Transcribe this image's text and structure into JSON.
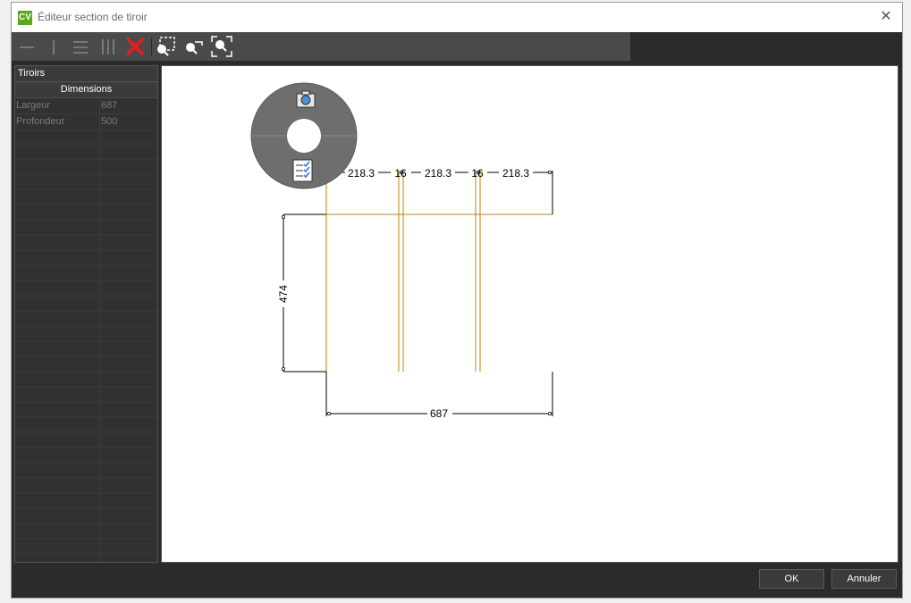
{
  "window": {
    "app_icon_text": "CV",
    "title": "Éditeur section de tiroir"
  },
  "toolbar": {
    "items": [
      {
        "icon": "horizontal-line-icon"
      },
      {
        "icon": "vertical-line-icon"
      },
      {
        "icon": "horizontal-lines-icon"
      },
      {
        "icon": "vertical-lines-icon"
      },
      {
        "icon": "delete-icon"
      },
      {
        "icon": "zoom-window-icon"
      },
      {
        "icon": "zoom-out-icon"
      },
      {
        "icon": "zoom-extents-icon"
      }
    ]
  },
  "panel": {
    "header": "Tiroirs",
    "section": "Dimensions",
    "rows": [
      {
        "label": "Largeur",
        "value": "687"
      },
      {
        "label": "Profondeur",
        "value": "500"
      }
    ]
  },
  "drawing": {
    "dims_top": [
      "218.3",
      "16",
      "218.3",
      "16",
      "218.3"
    ],
    "dim_left": "474",
    "dim_bottom": "687",
    "line_color": "#b8860b"
  },
  "radial_menu": {
    "items": [
      {
        "icon": "camera-icon"
      },
      {
        "icon": "checklist-icon"
      }
    ]
  },
  "buttons": {
    "ok": "OK",
    "cancel": "Annuler"
  }
}
